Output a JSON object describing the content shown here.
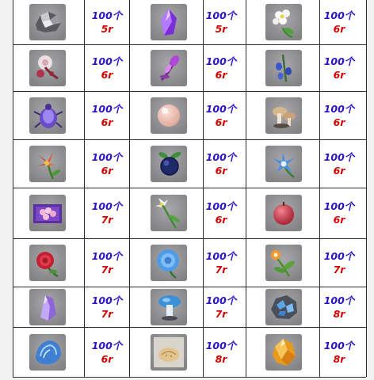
{
  "table": {
    "rows": [
      [
        {
          "item_icon": "crystal-chunk-icon",
          "quantity": "100个",
          "price": "5r"
        },
        {
          "item_icon": "purple-crystal-icon",
          "quantity": "100个",
          "price": "5r"
        },
        {
          "item_icon": "white-flower-icon",
          "quantity": "100个",
          "price": "6r"
        }
      ],
      [
        {
          "item_icon": "dandelion-seed-icon",
          "quantity": "100个",
          "price": "6r"
        },
        {
          "item_icon": "violet-bud-icon",
          "quantity": "100个",
          "price": "6r"
        },
        {
          "item_icon": "blue-bell-flower-icon",
          "quantity": "100个",
          "price": "6r"
        }
      ],
      [
        {
          "item_icon": "purple-beetle-icon",
          "quantity": "100个",
          "price": "6r"
        },
        {
          "item_icon": "pearl-icon",
          "quantity": "100个",
          "price": "6r"
        },
        {
          "item_icon": "mushroom-cluster-icon",
          "quantity": "100个",
          "price": "6r"
        }
      ],
      [
        {
          "item_icon": "red-lily-icon",
          "quantity": "100个",
          "price": "6r"
        },
        {
          "item_icon": "dark-berry-icon",
          "quantity": "100个",
          "price": "6r"
        },
        {
          "item_icon": "blue-snowflake-flower-icon",
          "quantity": "100个",
          "price": "6r"
        }
      ],
      [
        {
          "item_icon": "pink-coral-box-icon",
          "quantity": "100个",
          "price": "7r"
        },
        {
          "item_icon": "white-lily-icon",
          "quantity": "100个",
          "price": "6r"
        },
        {
          "item_icon": "red-fruit-icon",
          "quantity": "100个",
          "price": "6r"
        }
      ],
      [
        {
          "item_icon": "red-rose-icon",
          "quantity": "100个",
          "price": "7r"
        },
        {
          "item_icon": "blue-rose-icon",
          "quantity": "100个",
          "price": "7r"
        },
        {
          "item_icon": "orange-flower-sprig-icon",
          "quantity": "100个",
          "price": "7r"
        }
      ],
      [
        {
          "item_icon": "violet-crystal-shard-icon",
          "quantity": "100个",
          "price": "7r"
        },
        {
          "item_icon": "blue-mushroom-icon",
          "quantity": "100个",
          "price": "7r"
        },
        {
          "item_icon": "blue-ore-icon",
          "quantity": "100个",
          "price": "8r"
        }
      ],
      [
        {
          "item_icon": "blue-shell-icon",
          "quantity": "100个",
          "price": "6r"
        },
        {
          "item_icon": "sand-pouch-icon",
          "quantity": "100个",
          "price": "8r"
        },
        {
          "item_icon": "amber-crystal-icon",
          "quantity": "100个",
          "price": "8r"
        }
      ]
    ]
  },
  "colors": {
    "quantity_text": "#2a14c8",
    "price_text": "#d40000",
    "grid_line": "#2c2c2c",
    "icon_background": "#8f8f91"
  }
}
